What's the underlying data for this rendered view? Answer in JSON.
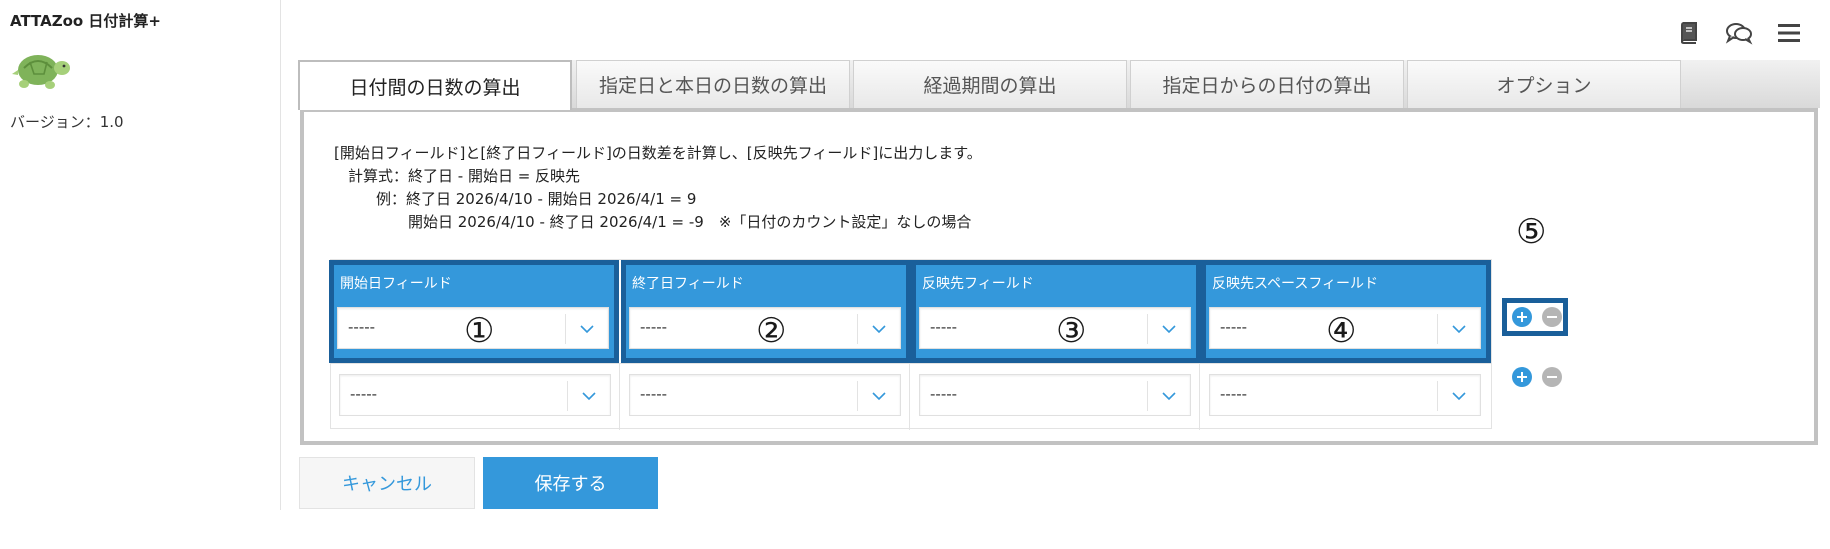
{
  "sidebar": {
    "app_title": "ATTAZoo 日付計算+",
    "version": "バージョン：1.0",
    "logo_icon": "turtle-icon"
  },
  "top_icons": [
    "book-icon",
    "chat-icon",
    "menu-icon"
  ],
  "tabs": [
    {
      "label": "日付間の日数の算出",
      "active": true
    },
    {
      "label": "指定日と本日の日数の算出",
      "active": false
    },
    {
      "label": "経過期間の算出",
      "active": false
    },
    {
      "label": "指定日からの日付の算出",
      "active": false
    },
    {
      "label": "オプション",
      "active": false
    }
  ],
  "description": {
    "line1": "[開始日フィールド]と[終了日フィールド]の日数差を計算し、[反映先フィールド]に出力します。",
    "line2": "計算式：終了日 - 開始日 = 反映先",
    "line3": "例：終了日 2026/4/10 - 開始日 2026/4/1 = 9",
    "line4": "開始日 2026/4/10 - 終了日 2026/4/1 = -9　※「日付のカウント設定」なしの場合"
  },
  "columns": [
    {
      "header": "開始日フィールド",
      "marker": "①"
    },
    {
      "header": "終了日フィールド",
      "marker": "②"
    },
    {
      "header": "反映先フィールド",
      "marker": "③"
    },
    {
      "header": "反映先スペースフィールド",
      "marker": "④"
    }
  ],
  "rows": [
    [
      "-----",
      "-----",
      "-----",
      "-----"
    ],
    [
      "-----",
      "-----",
      "-----",
      "-----"
    ]
  ],
  "row_control_marker": "⑤",
  "buttons": {
    "cancel": "キャンセル",
    "save": "保存する"
  },
  "colors": {
    "accent": "#3498db",
    "highlight_border": "#1a5f9a",
    "minus": "#b5b5b5"
  }
}
